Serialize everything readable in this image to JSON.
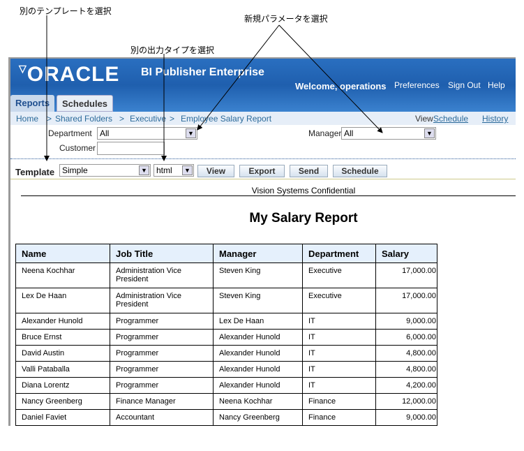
{
  "callouts": {
    "template": "別のテンプレートを選択",
    "output": "別の出力タイプを選択",
    "params": "新規パラメータを選択"
  },
  "header": {
    "logo": "ORACLE",
    "product": "BI Publisher Enterprise",
    "welcome": "Welcome, operations",
    "links": [
      "Preferences",
      "Sign Out",
      "Help"
    ]
  },
  "tabs": [
    "Reports",
    "Schedules"
  ],
  "breadcrumb": [
    "Home",
    "Shared Folders",
    "Executive",
    "Employee Salary Report"
  ],
  "view_links": {
    "view": "View",
    "schedule": "Schedule",
    "history": "History"
  },
  "params": {
    "department_label": "Department",
    "department_value": "All",
    "manager_label": "Manager",
    "manager_value": "All",
    "customer_label": "Customer",
    "customer_value": ""
  },
  "toolbar": {
    "template_label": "Template",
    "template_value": "Simple",
    "format_value": "html",
    "buttons": [
      "View",
      "Export",
      "Send",
      "Schedule"
    ]
  },
  "report": {
    "confidential": "Vision Systems Confidential",
    "title": "My Salary Report",
    "columns": [
      "Name",
      "Job Title",
      "Manager",
      "Department",
      "Salary"
    ],
    "rows": [
      [
        "Neena Kochhar",
        "Administration Vice President",
        "Steven King",
        "Executive",
        "17,000.00"
      ],
      [
        "Lex De Haan",
        "Administration Vice President",
        "Steven King",
        "Executive",
        "17,000.00"
      ],
      [
        "Alexander Hunold",
        "Programmer",
        "Lex De Haan",
        "IT",
        "9,000.00"
      ],
      [
        "Bruce Ernst",
        "Programmer",
        "Alexander Hunold",
        "IT",
        "6,000.00"
      ],
      [
        "David Austin",
        "Programmer",
        "Alexander Hunold",
        "IT",
        "4,800.00"
      ],
      [
        "Valli Pataballa",
        "Programmer",
        "Alexander Hunold",
        "IT",
        "4,800.00"
      ],
      [
        "Diana Lorentz",
        "Programmer",
        "Alexander Hunold",
        "IT",
        "4,200.00"
      ],
      [
        "Nancy Greenberg",
        "Finance Manager",
        "Neena Kochhar",
        "Finance",
        "12,000.00"
      ],
      [
        "Daniel Faviet",
        "Accountant",
        "Nancy Greenberg",
        "Finance",
        "9,000.00"
      ],
      [
        "",
        "",
        "",
        "",
        ""
      ]
    ]
  }
}
